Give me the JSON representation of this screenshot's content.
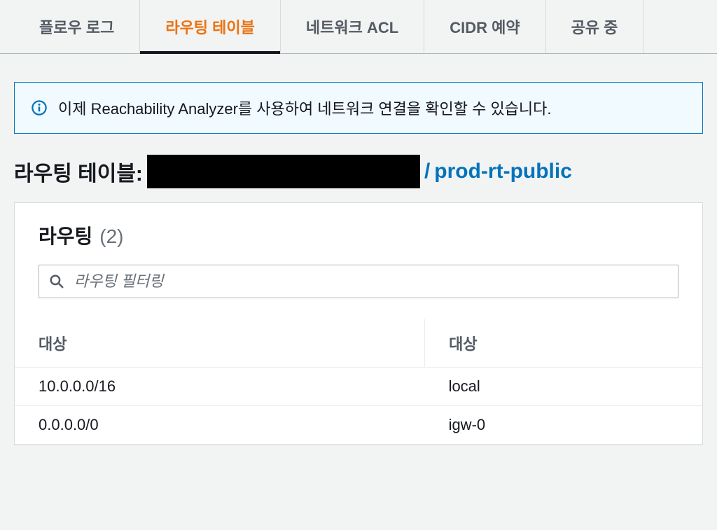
{
  "tabs": [
    {
      "label": "플로우 로그",
      "active": false
    },
    {
      "label": "라우팅 테이블",
      "active": true
    },
    {
      "label": "네트워크 ACL",
      "active": false
    },
    {
      "label": "CIDR 예약",
      "active": false
    },
    {
      "label": "공유 중",
      "active": false
    }
  ],
  "banner": {
    "text": "이제 Reachability Analyzer를 사용하여 네트워크 연결을 확인할 수 있습니다."
  },
  "routeTableHeading": {
    "label": "라우팅 테이블:",
    "separator": "/",
    "name": "prod-rt-public"
  },
  "panel": {
    "title": "라우팅",
    "count": "(2)",
    "filterPlaceholder": "라우팅 필터링"
  },
  "table": {
    "columns": [
      "대상",
      "대상"
    ],
    "rows": [
      {
        "destination": "10.0.0.0/16",
        "target": "local",
        "targetLink": false
      },
      {
        "destination": "0.0.0.0/0",
        "target": "igw-0",
        "targetLink": true
      }
    ]
  }
}
